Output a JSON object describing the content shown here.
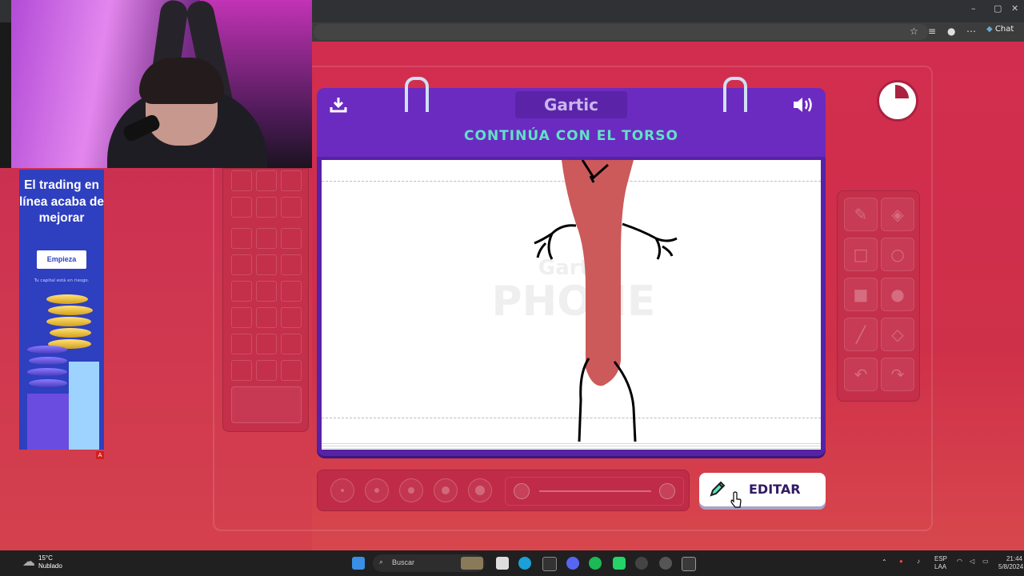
{
  "browser": {
    "chat_label": "Chat",
    "window_controls": [
      "–",
      "▢",
      "✕"
    ]
  },
  "ad": {
    "headline": "El trading en línea acaba de mejorar",
    "cta": "Empieza",
    "disclaimer": "Tu capital está en riesgo.",
    "badge": "A"
  },
  "game": {
    "logo": "Gartic",
    "instruction": "CONTINÚA CON EL TORSO",
    "watermark_top": "Gartic",
    "watermark_bottom": "PHONE",
    "edit_label": "EDITAR",
    "timer_remaining_fraction": 0.75,
    "brush_sizes": [
      1,
      2,
      3,
      4,
      5
    ],
    "icons": {
      "download": "download-icon",
      "sound": "speaker-icon",
      "edit": "pencil-icon",
      "tools": [
        "pencil-icon",
        "eraser-icon",
        "square-outline-icon",
        "circle-outline-icon",
        "square-filled-icon",
        "circle-filled-icon",
        "line-icon",
        "fill-bucket-icon",
        "undo-icon",
        "redo-icon"
      ]
    },
    "colors": {
      "accent_purple": "#6b2bc1",
      "instruction_green": "#5fe3c3",
      "background_red": "#d22d4f",
      "stroke_red": "#cc5a5a"
    }
  },
  "taskbar": {
    "weather_temp": "15°C",
    "weather_desc": "Nublado",
    "search_placeholder": "Buscar",
    "lang_line1": "ESP",
    "lang_line2": "LAA",
    "time": "21:44",
    "date": "5/8/2024"
  }
}
